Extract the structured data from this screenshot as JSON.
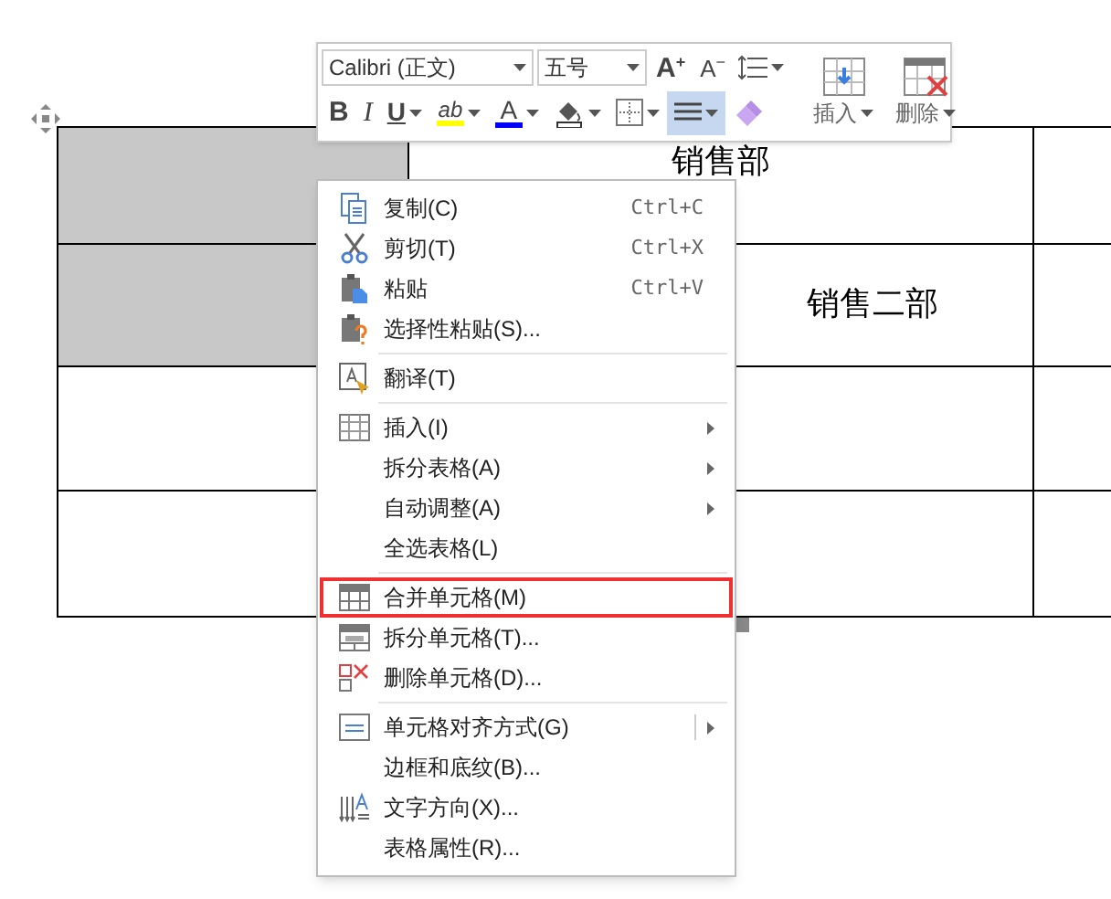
{
  "toolbar": {
    "font_field": "Calibri (正文)",
    "size_field": "五号",
    "row1_buttons": [
      {
        "kind": "grow",
        "label": "A",
        "sup": "+"
      },
      {
        "kind": "shrink",
        "label": "A",
        "sup": "−"
      },
      {
        "kind": "spacing"
      }
    ],
    "row2_buttons": [
      {
        "kind": "bold",
        "label": "B",
        "selected": false
      },
      {
        "kind": "italic",
        "label": "I",
        "selected": false
      },
      {
        "kind": "underline",
        "label": "U",
        "selected": false,
        "has_menu": true
      },
      {
        "kind": "highlight",
        "label": "ab",
        "color": "#ffff00",
        "selected": false,
        "has_menu": true
      },
      {
        "kind": "fontcolor",
        "label": "A",
        "color": "#0000ff",
        "selected": false,
        "has_menu": true
      },
      {
        "kind": "shading",
        "selected": false,
        "has_menu": true
      },
      {
        "kind": "borders",
        "selected": false,
        "has_menu": true
      },
      {
        "kind": "align",
        "selected": true,
        "has_menu": true
      },
      {
        "kind": "painter",
        "selected": false
      }
    ],
    "big_buttons": [
      {
        "kind": "insert",
        "label": "插入"
      },
      {
        "kind": "delete",
        "label": "删除"
      }
    ]
  },
  "table": {
    "rows": [
      {
        "cells": [
          {
            "shaded": true
          },
          {
            "text": "销售部",
            "merged": true
          },
          {}
        ]
      },
      {
        "cells": [
          {
            "shaded": true
          },
          {
            "text": "销售二部",
            "merged": true
          },
          {}
        ]
      },
      {
        "cells": [
          {
            "shaded": false
          },
          {
            "merged": true
          },
          {}
        ]
      },
      {
        "cells": [
          {
            "shaded": false
          },
          {
            "merged": true
          },
          {}
        ]
      }
    ]
  },
  "context_menu": {
    "items": [
      {
        "kind": "copy",
        "label": "复制(C)",
        "shortcut": "Ctrl+C",
        "selected": false
      },
      {
        "kind": "cut",
        "label": "剪切(T)",
        "shortcut": "Ctrl+X",
        "selected": false
      },
      {
        "kind": "paste",
        "label": "粘贴",
        "shortcut": "Ctrl+V",
        "selected": false
      },
      {
        "kind": "pastespecial",
        "label": "选择性粘贴(S)...",
        "selected": false
      },
      {
        "kind": "separator"
      },
      {
        "kind": "translate",
        "label": "翻译(T)",
        "selected": false
      },
      {
        "kind": "separator"
      },
      {
        "kind": "table",
        "label": "插入(I)",
        "submenu": true,
        "selected": false
      },
      {
        "kind": "plain",
        "label": "拆分表格(A)",
        "submenu": true,
        "selected": false
      },
      {
        "kind": "plain",
        "label": "自动调整(A)",
        "submenu": true,
        "selected": false
      },
      {
        "kind": "plain",
        "label": "全选表格(L)",
        "selected": false
      },
      {
        "kind": "separator"
      },
      {
        "kind": "merge",
        "label": "合并单元格(M)",
        "selected": true
      },
      {
        "kind": "split",
        "label": "拆分单元格(T)...",
        "selected": false
      },
      {
        "kind": "deletecell",
        "label": "删除单元格(D)...",
        "selected": false
      },
      {
        "kind": "separator"
      },
      {
        "kind": "align",
        "label": "单元格对齐方式(G)",
        "submenu": true,
        "split": true,
        "selected": false
      },
      {
        "kind": "plain",
        "label": "边框和底纹(B)...",
        "selected": false
      },
      {
        "kind": "direction",
        "label": "文字方向(X)...",
        "selected": false
      },
      {
        "kind": "plain",
        "label": "表格属性(R)...",
        "selected": false
      }
    ]
  }
}
